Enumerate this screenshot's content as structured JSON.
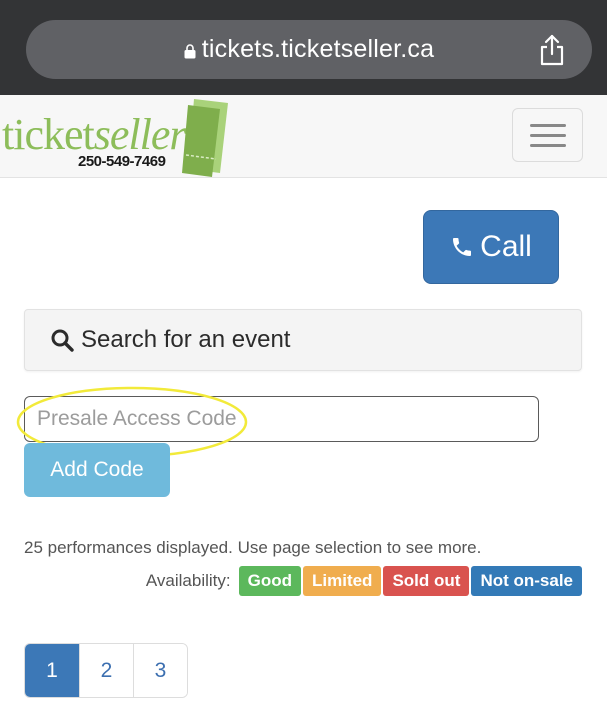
{
  "browser": {
    "url": "tickets.ticketseller.ca"
  },
  "header": {
    "logo_word_1": "ticket",
    "logo_word_2": "seller",
    "logo_phone": "250-549-7469",
    "menu_label": "Toggle navigation"
  },
  "call_button": {
    "label": "Call",
    "icon": "phone-icon"
  },
  "search": {
    "label": "Search for an event",
    "icon": "search-icon"
  },
  "presale": {
    "placeholder": "Presale Access Code",
    "value": "",
    "button_label": "Add Code",
    "highlight_color": "#f2ea3a"
  },
  "performances": {
    "text": "25 performances displayed. Use page selection to see more."
  },
  "availability": {
    "label": "Availability:",
    "badges": [
      {
        "label": "Good",
        "color": "#5cb85c"
      },
      {
        "label": "Limited",
        "color": "#f0ad4e"
      },
      {
        "label": "Sold out",
        "color": "#d9534f"
      },
      {
        "label": "Not on-sale",
        "color": "#337ab7"
      }
    ]
  },
  "pagination": {
    "pages": [
      "1",
      "2",
      "3"
    ],
    "active": "1"
  },
  "colors": {
    "primary": "#3c78b7",
    "info": "#6fbadc",
    "brand_green": "#8dbd5a"
  }
}
